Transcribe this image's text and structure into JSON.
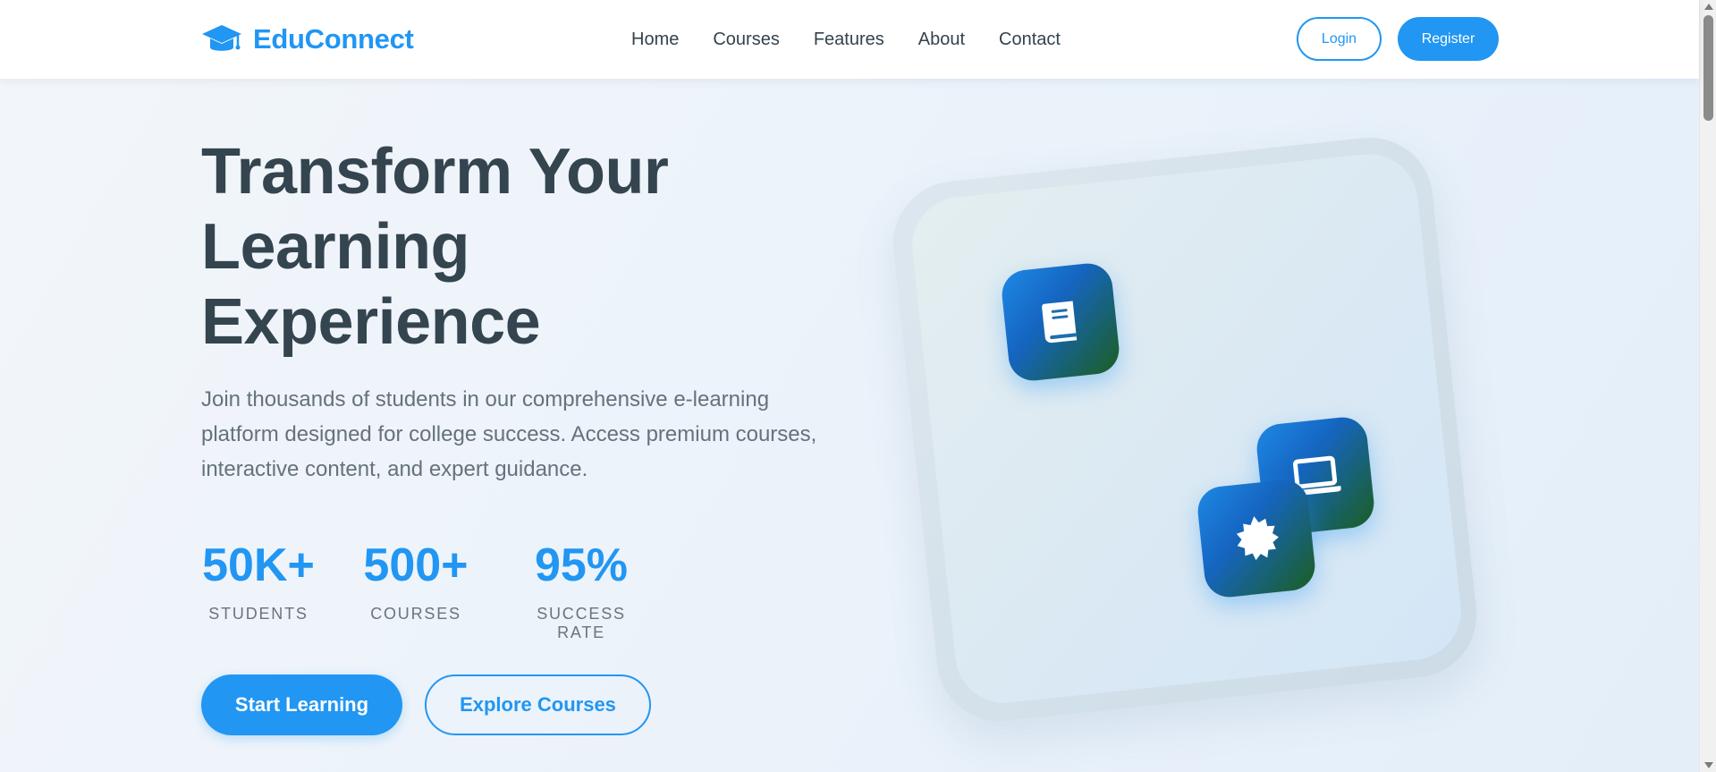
{
  "header": {
    "logo_icon": "graduation-cap-icon",
    "brand": "EduConnect",
    "nav": [
      "Home",
      "Courses",
      "Features",
      "About",
      "Contact"
    ],
    "login_label": "Login",
    "register_label": "Register"
  },
  "hero": {
    "title_lines": [
      "Transform Your",
      "Learning",
      "Experience"
    ],
    "description": "Join thousands of students in our comprehensive e-learning platform designed for college success. Access premium courses, interactive content, and expert guidance.",
    "stats": [
      {
        "value": "50K+",
        "label": "STUDENTS"
      },
      {
        "value": "500+",
        "label": "COURSES"
      },
      {
        "value": "95%",
        "label": "SUCCESS RATE"
      }
    ],
    "primary_cta": "Start Learning",
    "secondary_cta": "Explore Courses"
  },
  "illustration": {
    "icons": [
      "book-icon",
      "laptop-icon",
      "certificate-badge-icon"
    ]
  },
  "colors": {
    "accent": "#2196f3",
    "heading": "#34454f",
    "body_text": "#66727a",
    "tile_gradient_end": "#1b5e20"
  }
}
